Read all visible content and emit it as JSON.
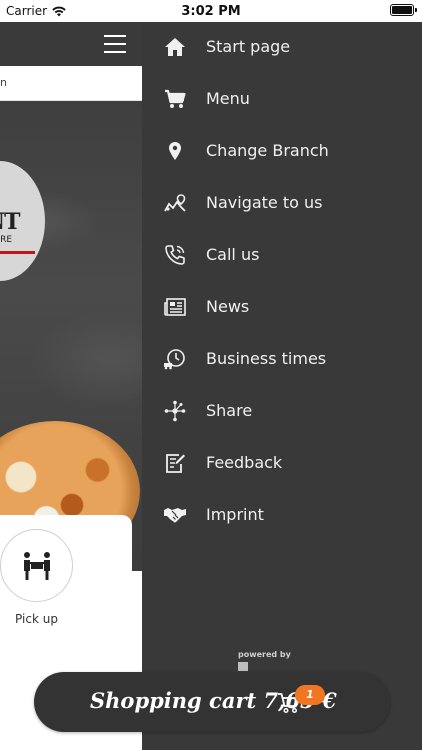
{
  "status_bar": {
    "carrier": "Carrier",
    "time": "3:02 PM"
  },
  "app": {
    "search_fragment": "n",
    "logo_text": "NT",
    "logo_sub": "ORE",
    "pickup_label": "Pick up"
  },
  "drawer": {
    "items": [
      {
        "label": "Start page",
        "icon": "home-icon"
      },
      {
        "label": "Menu",
        "icon": "cart-icon"
      },
      {
        "label": "Change Branch",
        "icon": "location-pin-icon"
      },
      {
        "label": "Navigate to us",
        "icon": "map-route-icon"
      },
      {
        "label": "Call us",
        "icon": "phone-icon"
      },
      {
        "label": "News",
        "icon": "newspaper-icon"
      },
      {
        "label": "Business times",
        "icon": "clock-delivery-icon"
      },
      {
        "label": "Share",
        "icon": "share-icon"
      },
      {
        "label": "Feedback",
        "icon": "feedback-icon"
      },
      {
        "label": "Imprint",
        "icon": "handshake-icon"
      }
    ],
    "powered_by": "powered by"
  },
  "cart": {
    "label": "Shopping cart 7,65 €",
    "badge": "1"
  },
  "colors": {
    "drawer_bg": "#393939",
    "header_bg": "#3a3a3a",
    "accent": "#f07622"
  }
}
